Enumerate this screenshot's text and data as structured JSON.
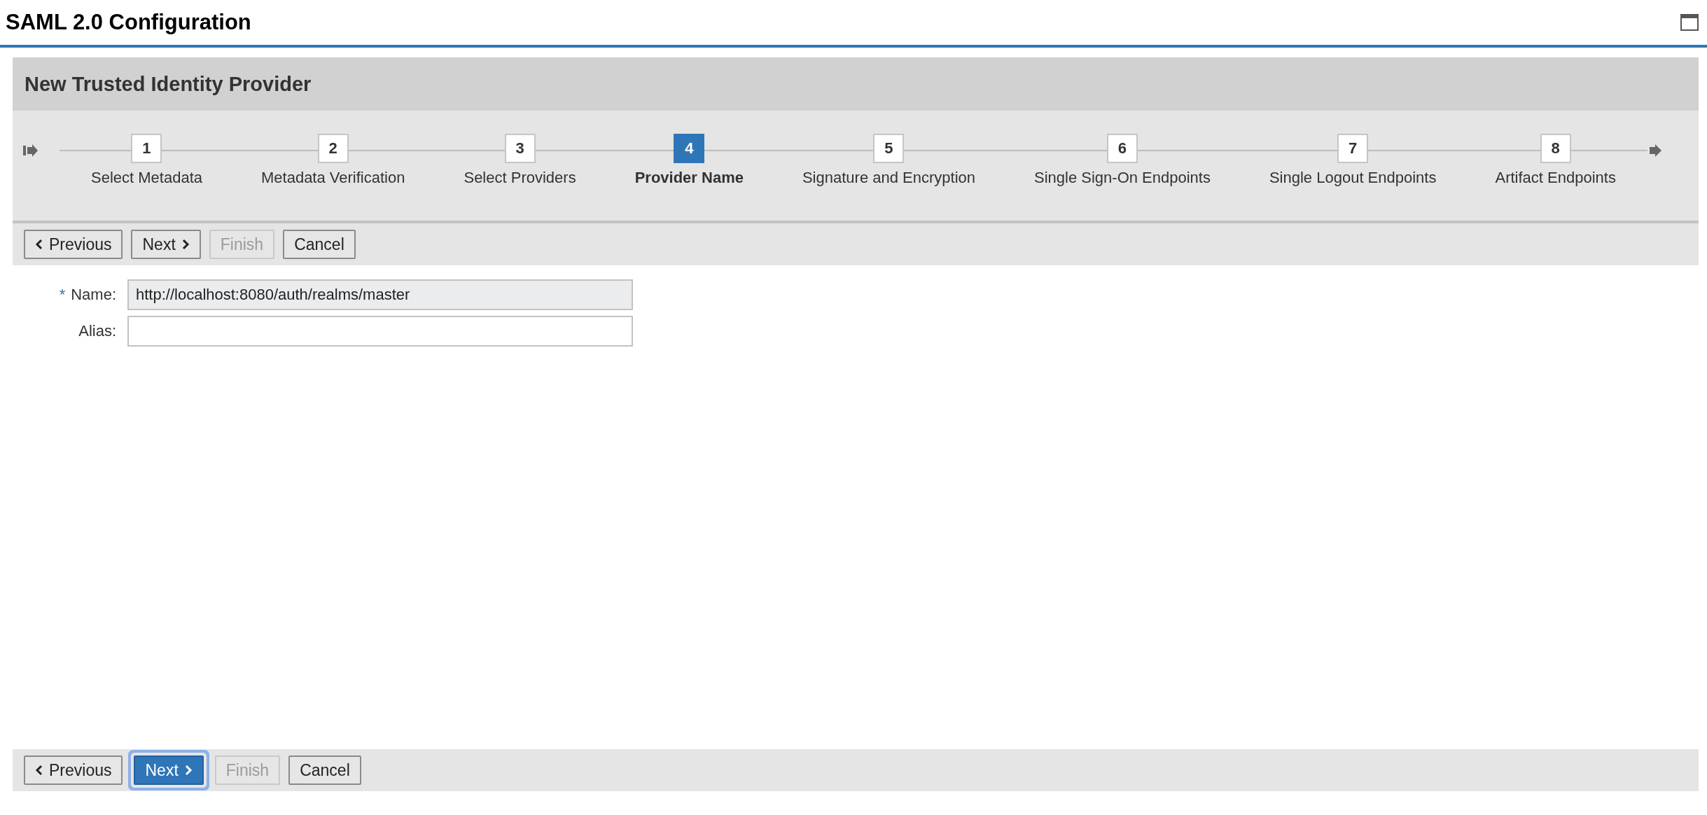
{
  "window": {
    "title": "SAML 2.0 Configuration"
  },
  "wizard": {
    "title": "New Trusted Identity Provider",
    "steps": [
      {
        "number": "1",
        "label": "Select Metadata",
        "selected": false
      },
      {
        "number": "2",
        "label": "Metadata Verification",
        "selected": false
      },
      {
        "number": "3",
        "label": "Select Providers",
        "selected": false
      },
      {
        "number": "4",
        "label": "Provider Name",
        "selected": true
      },
      {
        "number": "5",
        "label": "Signature and Encryption",
        "selected": false
      },
      {
        "number": "6",
        "label": "Single Sign-On Endpoints",
        "selected": false
      },
      {
        "number": "7",
        "label": "Single Logout Endpoints",
        "selected": false
      },
      {
        "number": "8",
        "label": "Artifact Endpoints",
        "selected": false
      }
    ],
    "top_buttons": [
      {
        "label": "Previous",
        "kind": "previous",
        "disabled": false,
        "focused": false
      },
      {
        "label": "Next",
        "kind": "next",
        "disabled": false,
        "focused": false
      },
      {
        "label": "Finish",
        "kind": "finish",
        "disabled": true,
        "focused": false
      },
      {
        "label": "Cancel",
        "kind": "cancel",
        "disabled": false,
        "focused": false
      }
    ],
    "fields": [
      {
        "label": "Name:",
        "required": true,
        "value": "http://localhost:8080/auth/realms/master",
        "readonly": true
      },
      {
        "label": "Alias:",
        "required": false,
        "readonly": false
      }
    ],
    "required_mark": "*",
    "bottom_buttons": [
      {
        "label": "Previous",
        "kind": "previous",
        "disabled": false,
        "focused": false
      },
      {
        "label": "Next",
        "kind": "next",
        "disabled": false,
        "focused": true
      },
      {
        "label": "Finish",
        "kind": "finish",
        "disabled": true,
        "focused": false
      },
      {
        "label": "Cancel",
        "kind": "cancel",
        "disabled": false,
        "focused": false
      }
    ]
  }
}
